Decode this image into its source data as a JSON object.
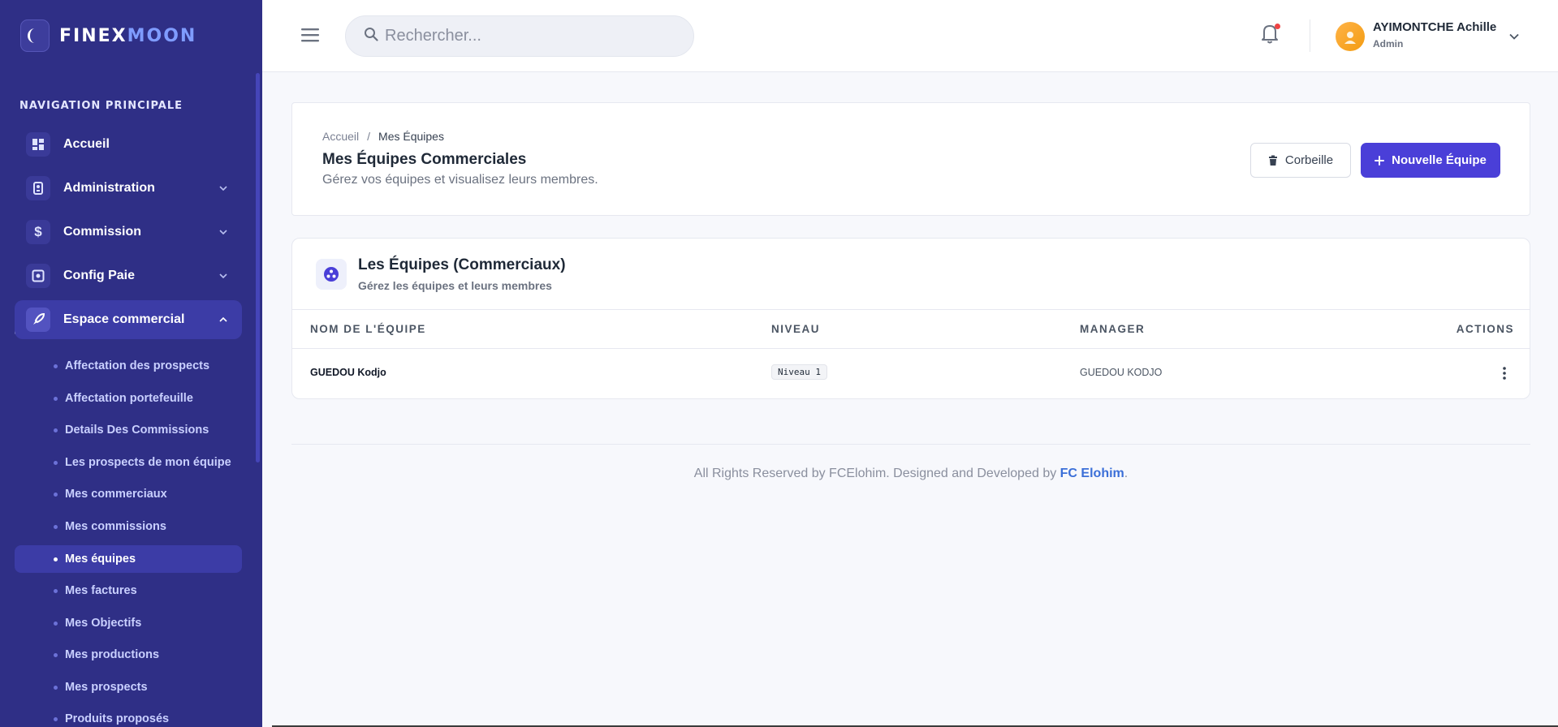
{
  "brand": {
    "part1": "FINEX",
    "part2": "MOON"
  },
  "sidebar": {
    "section_title": "NAVIGATION PRINCIPALE",
    "items": [
      {
        "label": "Accueil",
        "icon": "grid-icon"
      },
      {
        "label": "Administration",
        "icon": "admin-icon"
      },
      {
        "label": "Commission",
        "icon": "dollar-icon"
      },
      {
        "label": "Config Paie",
        "icon": "payroll-icon"
      },
      {
        "label": "Espace commercial",
        "icon": "rocket-icon",
        "active": true
      }
    ],
    "subitems": [
      {
        "label": "Affectation des prospects"
      },
      {
        "label": "Affectation portefeuille"
      },
      {
        "label": "Details Des Commissions"
      },
      {
        "label": "Les prospects de mon équipe"
      },
      {
        "label": "Mes commerciaux"
      },
      {
        "label": "Mes commissions"
      },
      {
        "label": "Mes équipes",
        "current": true
      },
      {
        "label": "Mes factures"
      },
      {
        "label": "Mes Objectifs"
      },
      {
        "label": "Mes productions"
      },
      {
        "label": "Mes prospects"
      },
      {
        "label": "Produits proposés"
      }
    ]
  },
  "topbar": {
    "search_placeholder": "Rechercher...",
    "user": {
      "name": "AYIMONTCHE Achille",
      "role": "Admin"
    }
  },
  "page": {
    "breadcrumb": {
      "home": "Accueil",
      "separator": "/",
      "current": "Mes Équipes"
    },
    "title": "Mes Équipes Commerciales",
    "subtitle": "Gérez vos équipes et visualisez leurs membres.",
    "trash_label": "Corbeille",
    "new_label": "Nouvelle Équipe"
  },
  "table": {
    "title": "Les Équipes (Commerciaux)",
    "subtitle": "Gérez les équipes et leurs membres",
    "columns": [
      "NOM DE L'ÉQUIPE",
      "NIVEAU",
      "MANAGER",
      "ACTIONS"
    ],
    "rows": [
      {
        "name": "GUEDOU Kodjo",
        "level": "Niveau 1",
        "manager": "GUEDOU KODJO"
      }
    ]
  },
  "footer": {
    "text": "All Rights Reserved by FCElohim. Designed and Developed by ",
    "link": "FC Elohim",
    "end": "."
  },
  "colors": {
    "sidebar": "#2f2f86",
    "accent": "#4a3fd8",
    "link": "#3b6fd8",
    "notification": "#ef4444"
  }
}
